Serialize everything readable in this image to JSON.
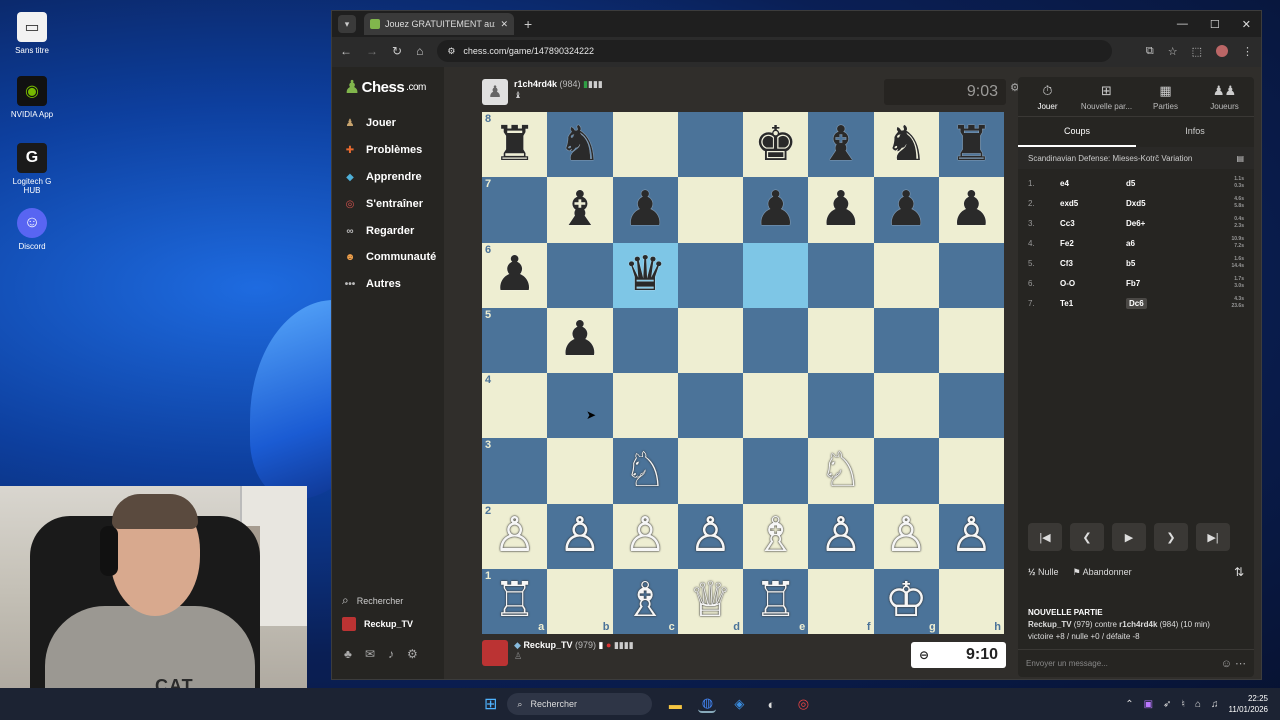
{
  "desktop": {
    "icons": [
      {
        "label": "Sans titre",
        "icon": "blank-window-icon"
      },
      {
        "label": "NVIDIA App",
        "icon": "nvidia-icon"
      },
      {
        "label": "Logitech G HUB",
        "icon": "logitech-g-icon"
      },
      {
        "label": "Discord",
        "icon": "discord-icon"
      }
    ]
  },
  "browser": {
    "tab_title": "Jouez GRATUITEMENT aux éche",
    "url": "chess.com/game/147890324222"
  },
  "nav": {
    "logo": "Chess",
    "logo_suffix": ".com",
    "items": [
      {
        "label": "Jouer",
        "icon": "play-pawn-icon",
        "color": "#c8a46e"
      },
      {
        "label": "Problèmes",
        "icon": "puzzle-icon",
        "color": "#e86a2f"
      },
      {
        "label": "Apprendre",
        "icon": "learn-cap-icon",
        "color": "#4fb0d8"
      },
      {
        "label": "S'entraîner",
        "icon": "practice-target-icon",
        "color": "#d9534f"
      },
      {
        "label": "Regarder",
        "icon": "binoculars-icon",
        "color": "#aaa"
      },
      {
        "label": "Communauté",
        "icon": "community-icon",
        "color": "#f0a04b"
      },
      {
        "label": "Autres",
        "icon": "more-dots-icon",
        "color": "#aaa"
      }
    ],
    "search": "Rechercher",
    "user": "Reckup_TV"
  },
  "game": {
    "top_player": {
      "name": "r1ch4rd4k",
      "rating": "(984)"
    },
    "bottom_player": {
      "name": "Reckup_TV",
      "rating": "(979)"
    },
    "top_clock": "9:03",
    "bottom_clock": "9:10",
    "board": [
      [
        "♜",
        "♞",
        "",
        "",
        "♚",
        "♝",
        "♞",
        "♜"
      ],
      [
        "",
        "♝",
        "♟",
        "",
        "♟",
        "♟",
        "♟",
        "♟"
      ],
      [
        "♟",
        "",
        "♛",
        "",
        "",
        "",
        "",
        ""
      ],
      [
        "",
        "♟",
        "",
        "",
        "",
        "",
        "",
        ""
      ],
      [
        "",
        "",
        "",
        "",
        "",
        "",
        "",
        ""
      ],
      [
        "",
        "",
        "♘",
        "",
        "",
        "♘",
        "",
        ""
      ],
      [
        "♙",
        "♙",
        "♙",
        "♙",
        "♗",
        "♙",
        "♙",
        "♙"
      ],
      [
        "♖",
        "",
        "♗",
        "♕",
        "♖",
        "",
        "♔",
        ""
      ]
    ],
    "highlights": [
      [
        2,
        2
      ],
      [
        2,
        4
      ]
    ],
    "ranks": [
      "8",
      "7",
      "6",
      "5",
      "4",
      "3",
      "2",
      "1"
    ],
    "files": [
      "a",
      "b",
      "c",
      "d",
      "e",
      "f",
      "g",
      "h"
    ]
  },
  "panel": {
    "tabs": [
      {
        "label": "Jouer",
        "icon": "stopwatch-icon"
      },
      {
        "label": "Nouvelle par...",
        "icon": "plus-square-icon"
      },
      {
        "label": "Parties",
        "icon": "board-grid-icon"
      },
      {
        "label": "Joueurs",
        "icon": "players-icon"
      }
    ],
    "subtabs": [
      "Coups",
      "Infos"
    ],
    "opening": "Scandinavian Defense: Mieses-Kotrč Variation",
    "moves": [
      {
        "n": "1.",
        "w": "e4",
        "b": "d5",
        "t1": "1.1s",
        "t2": "0.3s"
      },
      {
        "n": "2.",
        "w": "exd5",
        "b": "Dxd5",
        "t1": "4.6s",
        "t2": "5.8s"
      },
      {
        "n": "3.",
        "w": "Cc3",
        "b": "De6+",
        "t1": "0.4s",
        "t2": "2.3s"
      },
      {
        "n": "4.",
        "w": "Fe2",
        "b": "a6",
        "t1": "10.9s",
        "t2": "7.2s"
      },
      {
        "n": "5.",
        "w": "Cf3",
        "b": "b5",
        "t1": "1.6s",
        "t2": "14.4s"
      },
      {
        "n": "6.",
        "w": "O-O",
        "b": "Fb7",
        "t1": "1.7s",
        "t2": "3.0s"
      },
      {
        "n": "7.",
        "w": "Te1",
        "b": "Dc6",
        "t1": "4.3s",
        "t2": "23.6s"
      }
    ],
    "draw": "Nulle",
    "draw_glyph": "½",
    "resign": "Abandonner",
    "newgame_title": "NOUVELLE PARTIE",
    "newgame_line1_a": "Reckup_TV",
    "newgame_line1_b": " (979) contre ",
    "newgame_line1_c": "r1ch4rd4k",
    "newgame_line1_d": " (984) (10 min)",
    "newgame_line2": "victoire +8 / nulle +0 / défaite -8",
    "message_placeholder": "Envoyer un message..."
  },
  "webcam": {
    "shirt_logo": "CAT"
  },
  "taskbar": {
    "search": "Rechercher",
    "time": "22:25",
    "date": "11/01/2026"
  }
}
